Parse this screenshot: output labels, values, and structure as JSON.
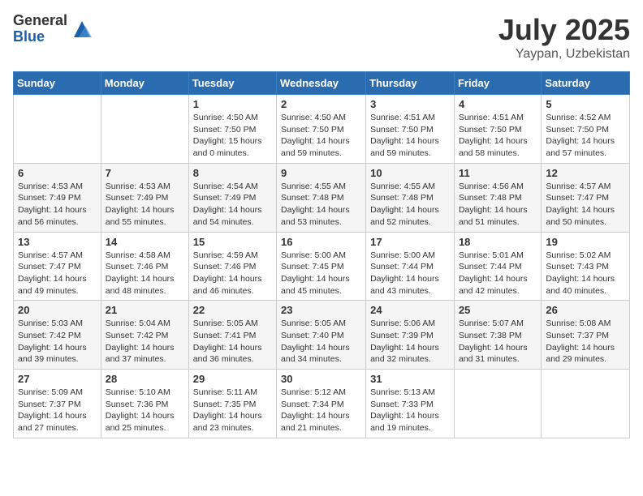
{
  "logo": {
    "general": "General",
    "blue": "Blue"
  },
  "title": {
    "month": "July 2025",
    "location": "Yaypan, Uzbekistan"
  },
  "headers": [
    "Sunday",
    "Monday",
    "Tuesday",
    "Wednesday",
    "Thursday",
    "Friday",
    "Saturday"
  ],
  "weeks": [
    [
      {
        "day": "",
        "info": ""
      },
      {
        "day": "",
        "info": ""
      },
      {
        "day": "1",
        "info": "Sunrise: 4:50 AM\nSunset: 7:50 PM\nDaylight: 15 hours\nand 0 minutes."
      },
      {
        "day": "2",
        "info": "Sunrise: 4:50 AM\nSunset: 7:50 PM\nDaylight: 14 hours\nand 59 minutes."
      },
      {
        "day": "3",
        "info": "Sunrise: 4:51 AM\nSunset: 7:50 PM\nDaylight: 14 hours\nand 59 minutes."
      },
      {
        "day": "4",
        "info": "Sunrise: 4:51 AM\nSunset: 7:50 PM\nDaylight: 14 hours\nand 58 minutes."
      },
      {
        "day": "5",
        "info": "Sunrise: 4:52 AM\nSunset: 7:50 PM\nDaylight: 14 hours\nand 57 minutes."
      }
    ],
    [
      {
        "day": "6",
        "info": "Sunrise: 4:53 AM\nSunset: 7:49 PM\nDaylight: 14 hours\nand 56 minutes."
      },
      {
        "day": "7",
        "info": "Sunrise: 4:53 AM\nSunset: 7:49 PM\nDaylight: 14 hours\nand 55 minutes."
      },
      {
        "day": "8",
        "info": "Sunrise: 4:54 AM\nSunset: 7:49 PM\nDaylight: 14 hours\nand 54 minutes."
      },
      {
        "day": "9",
        "info": "Sunrise: 4:55 AM\nSunset: 7:48 PM\nDaylight: 14 hours\nand 53 minutes."
      },
      {
        "day": "10",
        "info": "Sunrise: 4:55 AM\nSunset: 7:48 PM\nDaylight: 14 hours\nand 52 minutes."
      },
      {
        "day": "11",
        "info": "Sunrise: 4:56 AM\nSunset: 7:48 PM\nDaylight: 14 hours\nand 51 minutes."
      },
      {
        "day": "12",
        "info": "Sunrise: 4:57 AM\nSunset: 7:47 PM\nDaylight: 14 hours\nand 50 minutes."
      }
    ],
    [
      {
        "day": "13",
        "info": "Sunrise: 4:57 AM\nSunset: 7:47 PM\nDaylight: 14 hours\nand 49 minutes."
      },
      {
        "day": "14",
        "info": "Sunrise: 4:58 AM\nSunset: 7:46 PM\nDaylight: 14 hours\nand 48 minutes."
      },
      {
        "day": "15",
        "info": "Sunrise: 4:59 AM\nSunset: 7:46 PM\nDaylight: 14 hours\nand 46 minutes."
      },
      {
        "day": "16",
        "info": "Sunrise: 5:00 AM\nSunset: 7:45 PM\nDaylight: 14 hours\nand 45 minutes."
      },
      {
        "day": "17",
        "info": "Sunrise: 5:00 AM\nSunset: 7:44 PM\nDaylight: 14 hours\nand 43 minutes."
      },
      {
        "day": "18",
        "info": "Sunrise: 5:01 AM\nSunset: 7:44 PM\nDaylight: 14 hours\nand 42 minutes."
      },
      {
        "day": "19",
        "info": "Sunrise: 5:02 AM\nSunset: 7:43 PM\nDaylight: 14 hours\nand 40 minutes."
      }
    ],
    [
      {
        "day": "20",
        "info": "Sunrise: 5:03 AM\nSunset: 7:42 PM\nDaylight: 14 hours\nand 39 minutes."
      },
      {
        "day": "21",
        "info": "Sunrise: 5:04 AM\nSunset: 7:42 PM\nDaylight: 14 hours\nand 37 minutes."
      },
      {
        "day": "22",
        "info": "Sunrise: 5:05 AM\nSunset: 7:41 PM\nDaylight: 14 hours\nand 36 minutes."
      },
      {
        "day": "23",
        "info": "Sunrise: 5:05 AM\nSunset: 7:40 PM\nDaylight: 14 hours\nand 34 minutes."
      },
      {
        "day": "24",
        "info": "Sunrise: 5:06 AM\nSunset: 7:39 PM\nDaylight: 14 hours\nand 32 minutes."
      },
      {
        "day": "25",
        "info": "Sunrise: 5:07 AM\nSunset: 7:38 PM\nDaylight: 14 hours\nand 31 minutes."
      },
      {
        "day": "26",
        "info": "Sunrise: 5:08 AM\nSunset: 7:37 PM\nDaylight: 14 hours\nand 29 minutes."
      }
    ],
    [
      {
        "day": "27",
        "info": "Sunrise: 5:09 AM\nSunset: 7:37 PM\nDaylight: 14 hours\nand 27 minutes."
      },
      {
        "day": "28",
        "info": "Sunrise: 5:10 AM\nSunset: 7:36 PM\nDaylight: 14 hours\nand 25 minutes."
      },
      {
        "day": "29",
        "info": "Sunrise: 5:11 AM\nSunset: 7:35 PM\nDaylight: 14 hours\nand 23 minutes."
      },
      {
        "day": "30",
        "info": "Sunrise: 5:12 AM\nSunset: 7:34 PM\nDaylight: 14 hours\nand 21 minutes."
      },
      {
        "day": "31",
        "info": "Sunrise: 5:13 AM\nSunset: 7:33 PM\nDaylight: 14 hours\nand 19 minutes."
      },
      {
        "day": "",
        "info": ""
      },
      {
        "day": "",
        "info": ""
      }
    ]
  ]
}
